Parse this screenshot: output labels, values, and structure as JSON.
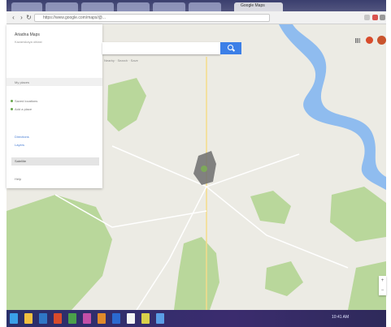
{
  "browser": {
    "tab_active_label": "Google Maps",
    "address": "https://www.google.com/maps/@...",
    "accent": "#3c7fe7"
  },
  "map": {
    "water_color": "#8fbcef",
    "park_color": "#b9d79b",
    "land_color": "#ecebe4",
    "highlight_color": "#6e6e6e",
    "labels": [
      "",
      "",
      "",
      "",
      ""
    ]
  },
  "panel": {
    "title": "Ariadna Maps",
    "subtitle": "Kazanskaya oblast",
    "section_label": "My places",
    "rows": [
      {
        "text": "Saved locations",
        "kind": "item"
      },
      {
        "text": "Add a place",
        "kind": "item"
      },
      {
        "text": "Directions",
        "kind": "link"
      },
      {
        "text": "Layers",
        "kind": "link"
      },
      {
        "text": "Satellite",
        "kind": "selected"
      },
      {
        "text": "Help",
        "kind": "item"
      }
    ]
  },
  "search": {
    "placeholder": "",
    "filters": "Nearby · Search · Save"
  },
  "taskbar": {
    "clock": "10:41 AM"
  },
  "icons": {
    "search": "search-icon",
    "apps": "apps-icon",
    "notifications": "bell-icon",
    "zoom_in": "plus-icon",
    "zoom_out": "minus-icon"
  }
}
